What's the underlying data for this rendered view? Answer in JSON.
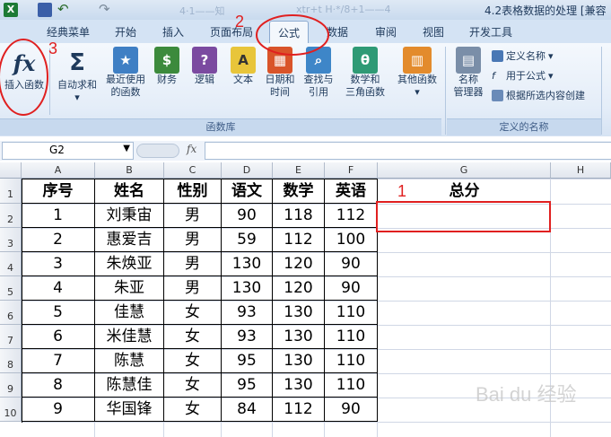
{
  "titlebar": {
    "doc_title": "4.2表格数据的处理",
    "compat_suffix": "[兼容",
    "faded_left": "4·1——知",
    "faded_mid": "xtr+t   H·*/8+1——4"
  },
  "tabs": [
    "经典菜单",
    "开始",
    "插入",
    "页面布局",
    "公式",
    "数据",
    "审阅",
    "视图",
    "开发工具"
  ],
  "active_tab": "公式",
  "ribbon": {
    "insert_function": "插入函数",
    "autosum": "自动求和",
    "recent": [
      "最近使用",
      "的函数"
    ],
    "financial": "财务",
    "logical": "逻辑",
    "text": "文本",
    "datetime": [
      "日期和",
      "时间"
    ],
    "lookup": [
      "查找与",
      "引用"
    ],
    "math": [
      "数学和",
      "三角函数"
    ],
    "more": "其他函数",
    "name_manager": [
      "名称",
      "管理器"
    ],
    "define_name": "定义名称",
    "use_in_formula": "用于公式",
    "create_from_selection": "根据所选内容创建",
    "group_library": "函数库",
    "group_names": "定义的名称"
  },
  "formula_bar": {
    "name_box": "G2",
    "fx": "fx",
    "content": ""
  },
  "sheet": {
    "columns": [
      "A",
      "B",
      "C",
      "D",
      "E",
      "F",
      "G",
      "H"
    ],
    "rows": [
      "1",
      "2",
      "3",
      "4",
      "5",
      "6",
      "7",
      "8",
      "9",
      "10"
    ],
    "header": [
      "序号",
      "姓名",
      "性别",
      "语文",
      "数学",
      "英语",
      "总分"
    ],
    "data": [
      [
        "1",
        "刘秉宙",
        "男",
        "90",
        "118",
        "112",
        ""
      ],
      [
        "2",
        "惠爱吉",
        "男",
        "59",
        "112",
        "100",
        ""
      ],
      [
        "3",
        "朱焕亚",
        "男",
        "130",
        "120",
        "90",
        ""
      ],
      [
        "4",
        "朱亚",
        "男",
        "130",
        "120",
        "90",
        ""
      ],
      [
        "5",
        "佳慧",
        "女",
        "93",
        "130",
        "110",
        ""
      ],
      [
        "6",
        "米佳慧",
        "女",
        "93",
        "130",
        "110",
        ""
      ],
      [
        "7",
        "陈慧",
        "女",
        "95",
        "130",
        "110",
        ""
      ],
      [
        "8",
        "陈慧佳",
        "女",
        "95",
        "130",
        "110",
        ""
      ],
      [
        "9",
        "华国锋",
        "女",
        "84",
        "112",
        "90",
        ""
      ]
    ]
  },
  "annotations": {
    "one": "1",
    "two": "2",
    "three": "3"
  },
  "watermark": "Bai du 经验",
  "colors": {
    "annotation_red": "#e02020",
    "ribbon_bg": "#dfe9f5"
  }
}
